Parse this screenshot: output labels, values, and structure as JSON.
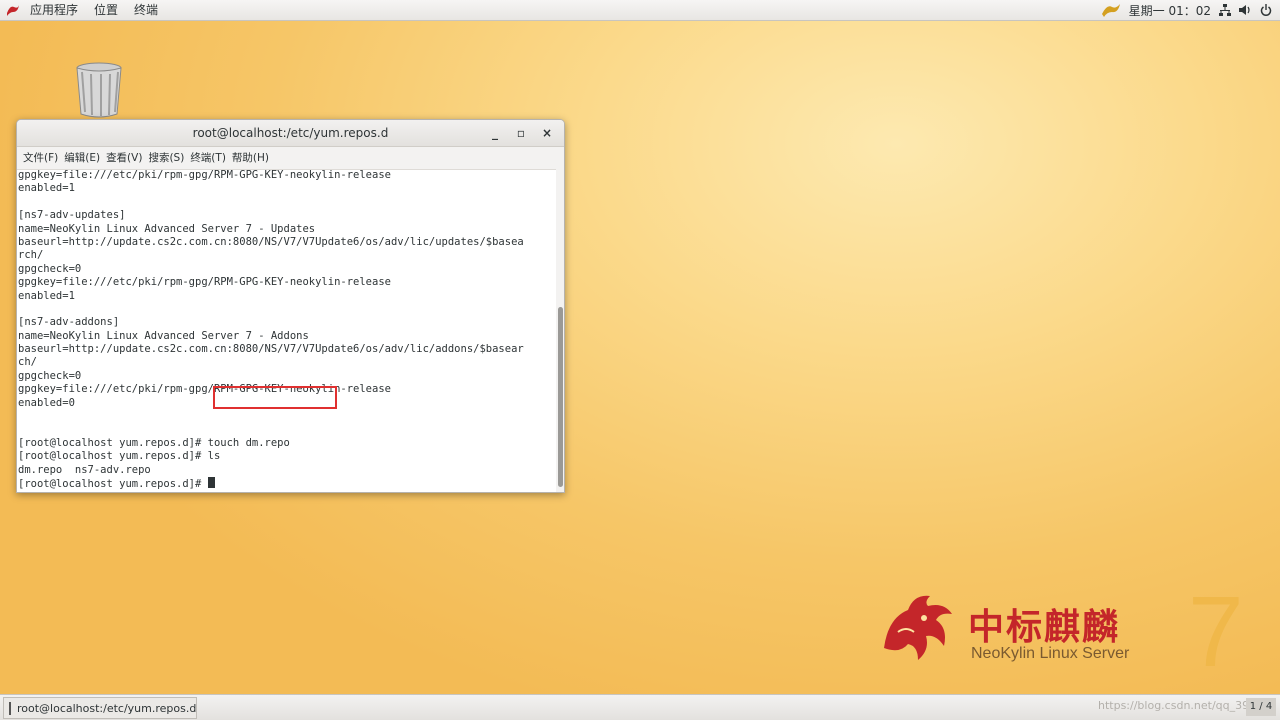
{
  "top_panel": {
    "menus": [
      "应用程序",
      "位置",
      "终端"
    ],
    "clock": "星期一 01：02",
    "icons": [
      "neokylin-logo-icon",
      "network-icon",
      "volume-icon",
      "power-icon"
    ]
  },
  "desktop": {
    "trash_icon": "trash-icon"
  },
  "terminal": {
    "title": "root@localhost:/etc/yum.repos.d",
    "window_buttons": [
      "_",
      "▫",
      "×"
    ],
    "menus": [
      "文件(F)",
      "编辑(E)",
      "查看(V)",
      "搜索(S)",
      "终端(T)",
      "帮助(H)"
    ],
    "lines": [
      "gpgkey=file:///etc/pki/rpm-gpg/RPM-GPG-KEY-neokylin-release",
      "enabled=1",
      "",
      "[ns7-adv-updates]",
      "name=NeoKylin Linux Advanced Server 7 - Updates",
      "baseurl=http://update.cs2c.com.cn:8080/NS/V7/V7Update6/os/adv/lic/updates/$basea",
      "rch/",
      "gpgcheck=0",
      "gpgkey=file:///etc/pki/rpm-gpg/RPM-GPG-KEY-neokylin-release",
      "enabled=1",
      "",
      "[ns7-adv-addons]",
      "name=NeoKylin Linux Advanced Server 7 - Addons",
      "baseurl=http://update.cs2c.com.cn:8080/NS/V7/V7Update6/os/adv/lic/addons/$basear",
      "ch/",
      "gpgcheck=0",
      "gpgkey=file:///etc/pki/rpm-gpg/RPM-GPG-KEY-neokylin-release",
      "enabled=0",
      "",
      "",
      "[root@localhost yum.repos.d]# touch dm.repo",
      "[root@localhost yum.repos.d]# ls",
      "dm.repo  ns7-adv.repo",
      "[root@localhost yum.repos.d]# "
    ]
  },
  "brand": {
    "cn": "中标麒麟",
    "en": "NeoKylin Linux Server",
    "version": "7"
  },
  "taskbar": {
    "window_item": "root@localhost:/etc/yum.repos.d",
    "watermark": "https://blog.csdn.net/qq_3958",
    "workspace": "1 / 4"
  },
  "colors": {
    "highlight": "#e03030",
    "brand_red": "#c4262a"
  }
}
